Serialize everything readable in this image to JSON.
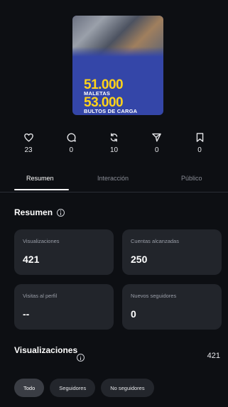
{
  "thumbnail": {
    "line1": "51.000",
    "line2": "MALETAS",
    "line3": "53.000",
    "line4": "BULTOS DE CARGA"
  },
  "engagement": [
    {
      "icon": "heart-icon",
      "value": "23"
    },
    {
      "icon": "comment-icon",
      "value": "0"
    },
    {
      "icon": "repost-icon",
      "value": "10"
    },
    {
      "icon": "send-icon",
      "value": "0"
    },
    {
      "icon": "bookmark-icon",
      "value": "0"
    }
  ],
  "tabs": [
    {
      "label": "Resumen",
      "active": true
    },
    {
      "label": "Interacción",
      "active": false
    },
    {
      "label": "Público",
      "active": false
    }
  ],
  "summary": {
    "title": "Resumen",
    "cards": [
      {
        "label": "Visualizaciones",
        "value": "421"
      },
      {
        "label": "Cuentas alcanzadas",
        "value": "250"
      },
      {
        "label": "Visitas al perfil",
        "value": "--"
      },
      {
        "label": "Nuevos seguidores",
        "value": "0"
      }
    ]
  },
  "views": {
    "title": "Visualizaciones",
    "total": "421",
    "filters": [
      {
        "label": "Todo",
        "active": true
      },
      {
        "label": "Seguidores",
        "active": false
      },
      {
        "label": "No seguidores",
        "active": false
      }
    ]
  },
  "colors": {
    "background": "#0d0f13",
    "card": "#22252b",
    "thumbnail_blue": "#3446a8",
    "thumbnail_yellow": "#ffd31a"
  }
}
